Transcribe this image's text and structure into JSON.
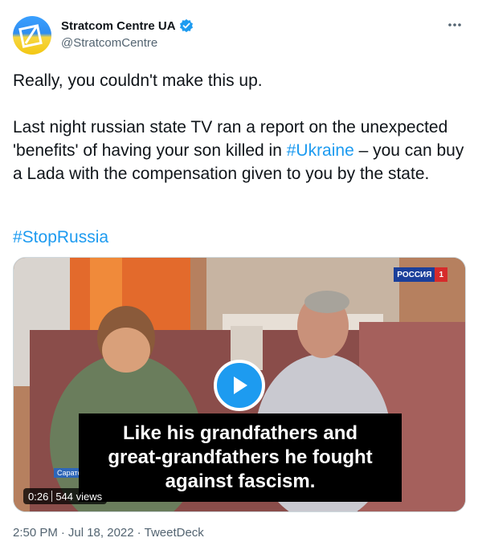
{
  "author": {
    "display_name": "Stratcom Centre UA",
    "handle": "@StratcomCentre",
    "verified": true,
    "avatar_icon": "stratcom-logo",
    "more_icon": "more-horizontal-icon"
  },
  "tweet": {
    "line1": "Really, you couldn't make this up.",
    "p2_before": "Last night russian state TV ran a report on the unexpected 'benefits' of having your son killed in ",
    "p2_hashtag": "#Ukraine",
    "p2_after": " – you can buy a Lada with the compensation given to you by the state.",
    "hashtag2": "#StopRussia"
  },
  "media": {
    "type": "video",
    "play_icon": "play-icon",
    "caption_lines": [
      "Like his grandfathers and",
      "great-grandfathers he fought",
      "against fascism."
    ],
    "channel_logo_word": "РОССИЯ",
    "channel_logo_number": "1",
    "location_label": "Сарато",
    "duration": "0:26",
    "views": "544 views"
  },
  "footer": {
    "time": "2:50 PM",
    "separator1": "·",
    "date": "Jul 18, 2022",
    "separator2": "·",
    "source": "TweetDeck"
  },
  "colors": {
    "link": "#1d9bf0",
    "text": "#0f1419",
    "secondary": "#536471"
  }
}
